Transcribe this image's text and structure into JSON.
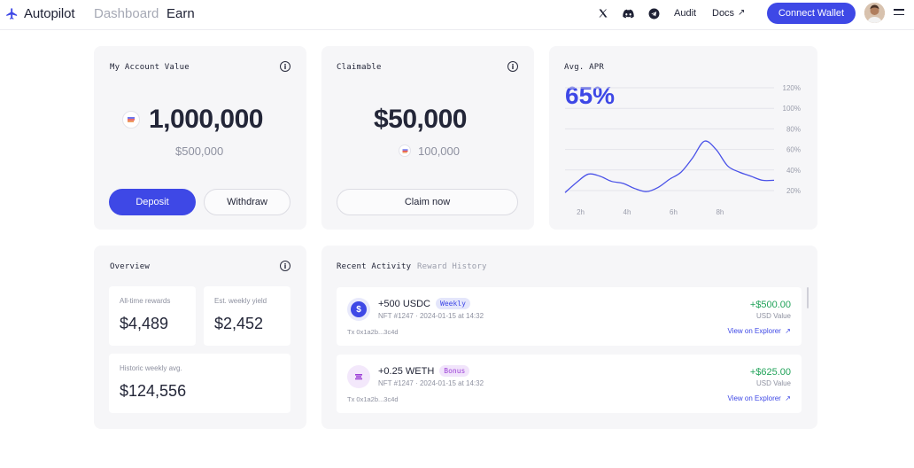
{
  "header": {
    "logo": "Autopilot",
    "nav": [
      "Dashboard",
      "Earn"
    ],
    "links": {
      "audit": "Audit",
      "docs": "Docs"
    },
    "connect_label": "Connect Wallet"
  },
  "account": {
    "title": "My Account Value",
    "value": "1,000,000",
    "usd": "$500,000",
    "deposit": "Deposit",
    "withdraw": "Withdraw"
  },
  "claimable": {
    "title": "Claimable",
    "value": "$50,000",
    "tokens": "100,000",
    "claim": "Claim now"
  },
  "apr": {
    "title": "Avg. APR",
    "value": "65%"
  },
  "chart_data": {
    "type": "line",
    "x_ticks": [
      "2h",
      "4h",
      "6h",
      "8h"
    ],
    "y_ticks": [
      "120%",
      "100%",
      "80%",
      "60%",
      "40%",
      "20%"
    ],
    "ylim": [
      20,
      120
    ],
    "x": [
      0,
      0.5,
      1,
      1.5,
      2,
      2.5,
      3,
      3.5,
      4,
      4.5,
      5,
      5.5,
      6,
      6.5,
      7,
      7.5,
      8,
      8.5,
      9
    ],
    "y": [
      18,
      28,
      36,
      34,
      29,
      27,
      22,
      19,
      23,
      31,
      38,
      52,
      68,
      60,
      44,
      38,
      34,
      30,
      30
    ],
    "grid": true,
    "color": "#4a52e8"
  },
  "overview": {
    "title": "Overview",
    "stats": [
      {
        "label": "All-time rewards",
        "value": "$4,489"
      },
      {
        "label": "Est. weekly yield",
        "value": "$2,452"
      },
      {
        "label": "Historic weekly avg.",
        "value": "$124,556"
      }
    ]
  },
  "activity": {
    "tabs": [
      "Recent Activity",
      "Reward History"
    ],
    "items": [
      {
        "title": "+500 USDC",
        "badge": "Weekly",
        "meta": "NFT #1247 · 2024-01-15 at 14:32",
        "tx": "Tx 0x1a2b...3c4d",
        "amount": "+$500.00",
        "usd": "USD Value",
        "link": "View on Explorer"
      },
      {
        "title": "+0.25 WETH",
        "badge": "Bonus",
        "meta": "NFT #1247 · 2024-01-15 at 14:32",
        "tx": "Tx 0x1a2b...3c4d",
        "amount": "+$625.00",
        "usd": "USD Value",
        "link": "View on Explorer"
      }
    ]
  },
  "colors": {
    "accent": "#3e48e6",
    "positive": "#22a35a",
    "card_bg": "#f6f6f8"
  }
}
